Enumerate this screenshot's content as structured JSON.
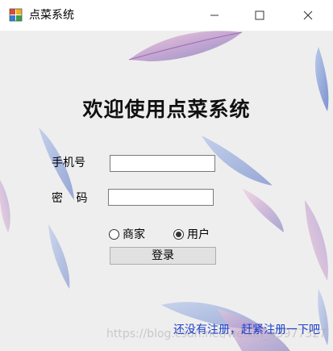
{
  "window": {
    "title": "点菜系统",
    "controls": {
      "minimize": "minimize-icon",
      "maximize": "maximize-icon",
      "close": "close-icon"
    }
  },
  "form": {
    "heading": "欢迎使用点菜系统",
    "phone_label": "手机号",
    "phone_value": "",
    "password_label": "密 码",
    "password_value": "",
    "roles": [
      {
        "label": "商家",
        "checked": false
      },
      {
        "label": "用户",
        "checked": true
      }
    ],
    "login_label": "登录",
    "register_link": "还没有注册，赶紧注册一下吧"
  },
  "watermark": "https://blog.csdn.net/weixin_43977327",
  "colors": {
    "link": "#1e40c8",
    "background": "#efeeee"
  }
}
